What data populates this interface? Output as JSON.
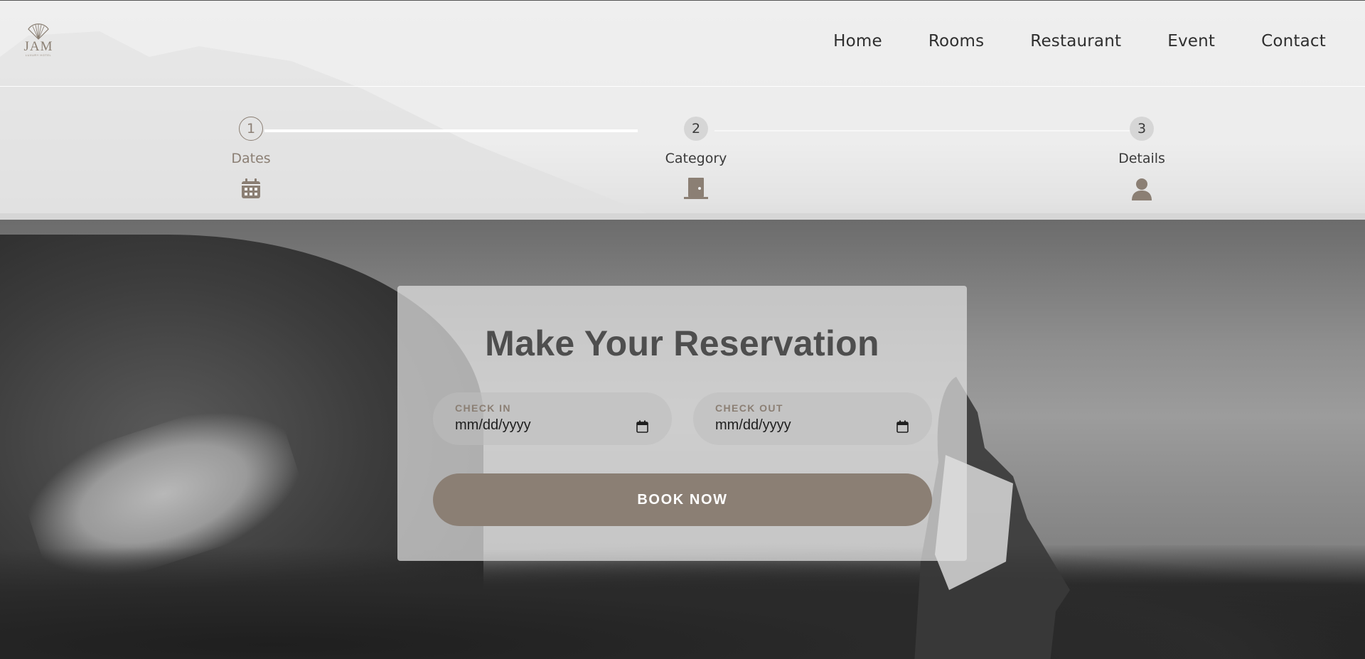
{
  "brand": {
    "logo_text": "JAM",
    "logo_subtext": "LUXURY HOTEL",
    "accent_color": "#8b7f74"
  },
  "nav": {
    "items": [
      {
        "label": "Home"
      },
      {
        "label": "Rooms"
      },
      {
        "label": "Restaurant"
      },
      {
        "label": "Event"
      },
      {
        "label": "Contact"
      }
    ]
  },
  "stepper": {
    "steps": [
      {
        "number": "1",
        "label": "Dates",
        "icon": "calendar-icon",
        "active": true
      },
      {
        "number": "2",
        "label": "Category",
        "icon": "door-icon",
        "active": false
      },
      {
        "number": "3",
        "label": "Details",
        "icon": "user-icon",
        "active": false
      }
    ]
  },
  "reservation": {
    "title": "Make Your Reservation",
    "check_in": {
      "label": "CHECK IN",
      "value": "mm/dd/yyyy"
    },
    "check_out": {
      "label": "CHECK OUT",
      "value": "mm/dd/yyyy"
    },
    "book_label": "BOOK NOW"
  }
}
